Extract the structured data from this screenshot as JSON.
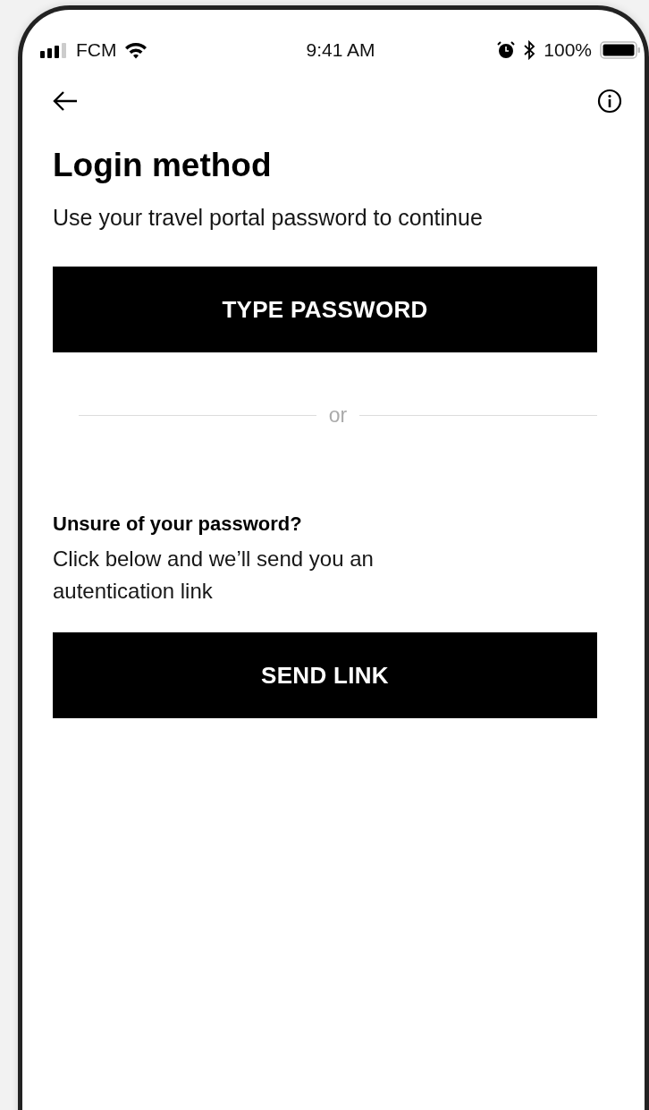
{
  "status_bar": {
    "carrier": "FCM",
    "time": "9:41 AM",
    "battery": "100%"
  },
  "title": "Login method",
  "subtitle": "Use your travel portal password to continue",
  "primary_button": "TYPE PASSWORD",
  "divider_text": "or",
  "help": {
    "heading": "Unsure of your password?",
    "text": "Click below and we’ll send you an autentication link",
    "button": "SEND LINK"
  }
}
